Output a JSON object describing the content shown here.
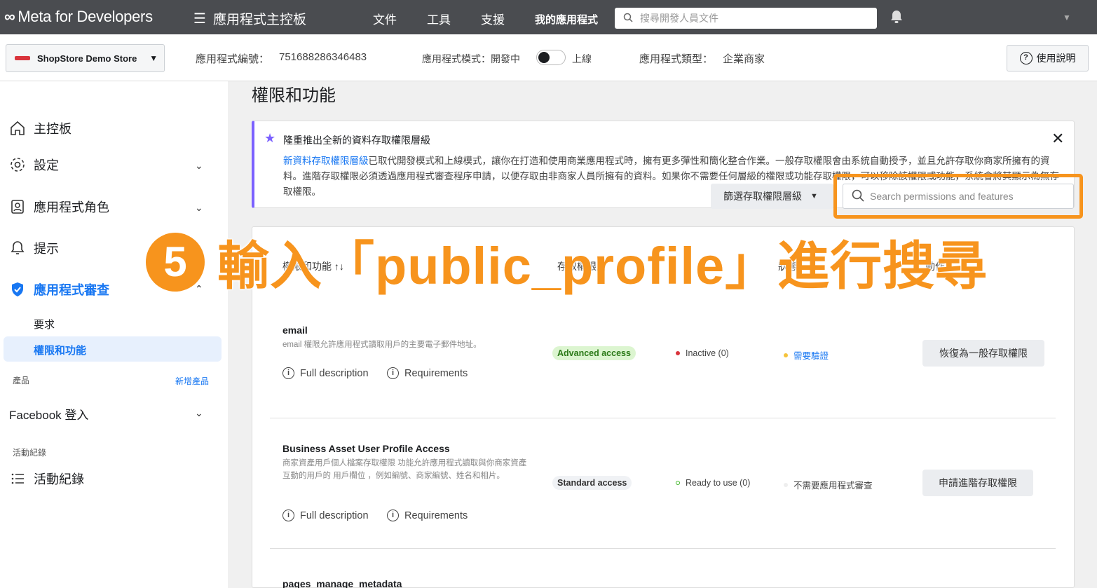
{
  "topbar": {
    "logo": "Meta for Developers",
    "app_dashboard": "應用程式主控板",
    "nav": [
      "文件",
      "工具",
      "支援",
      "我的應用程式"
    ],
    "search_placeholder": "搜尋開發人員文件"
  },
  "header": {
    "store_name": "ShopStore Demo Store",
    "app_id_label": "應用程式編號：",
    "app_id": "751688286346483",
    "mode_label": "應用程式模式：開發中",
    "mode_live": "上線",
    "type_label": "應用程式類型：",
    "type_value": "企業商家",
    "help": "使用說明"
  },
  "sidebar": {
    "dashboard": "主控板",
    "settings": "設定",
    "roles": "應用程式角色",
    "alerts": "提示",
    "review": "應用程式審查",
    "requests": "要求",
    "permissions": "權限和功能",
    "products_label": "產品",
    "add_product": "新增產品",
    "facebook_login": "Facebook 登入",
    "activity_label": "活動紀錄",
    "activity": "活動紀錄"
  },
  "main": {
    "title": "權限和功能",
    "notice_title": "隆重推出全新的資料存取權限層級",
    "notice_link": "新資料存取權限層級",
    "notice_body_1": "已取代開發模式和上線模式，讓你在打造和使用商業應用程式時，擁有更多彈性和簡化整合作業。一般存取權限會由系統自動授予，並且允許存取你商家所擁有的資料。進階存取權限必須透過應用程式審查程序申請，以便存取由非商家人員所擁有的資料。如果你不需要任何層級的權限或功能存取權限，可以移除該權限或功能，系統會將其顯示為無存取權限。",
    "filter": "篩選存取權限層級",
    "search_placeholder": "Search permissions and features",
    "col_name": "權限和功能 ↑↓",
    "col_level": "存取權限層",
    "col_status": "狀態",
    "col_action": "動作"
  },
  "overlay": {
    "step": "5",
    "text": "輸入「public_profile」進行搜尋"
  },
  "permissions": [
    {
      "name": "email",
      "desc": "email 權限允許應用程式讀取用戶的主要電子郵件地址。",
      "full_desc": "Full description",
      "requirements": "Requirements",
      "access": "Advanced access",
      "status": "Inactive (0)",
      "review": "需要驗證",
      "action": "恢復為一般存取權限"
    },
    {
      "name": "Business Asset User Profile Access",
      "desc": "商家資產用戶個人檔案存取權限 功能允許應用程式讀取與你商家資產互動的用戶的 用戶欄位 ，例如編號、商家編號、姓名和相片。",
      "full_desc": "Full description",
      "requirements": "Requirements",
      "access": "Standard access",
      "status": "Ready to use (0)",
      "review": "不需要應用程式審查",
      "action": "申請進階存取權限"
    },
    {
      "name": "pages_manage_metadata"
    }
  ],
  "colors": {
    "accent": "#f7941d",
    "link": "#1877f2",
    "topbar": "#4a4c50"
  }
}
